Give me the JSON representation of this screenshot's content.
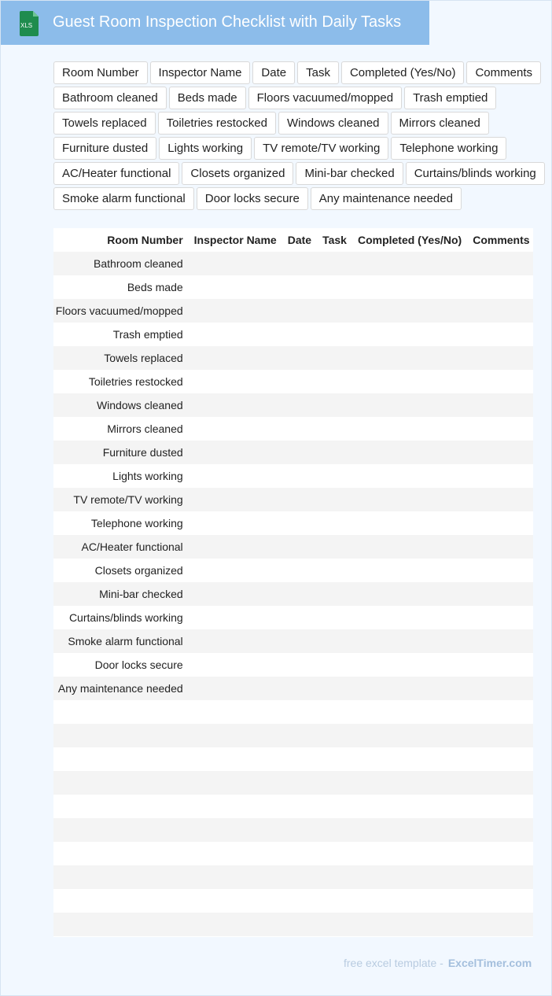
{
  "header": {
    "title": "Guest Room Inspection Checklist with Daily Tasks",
    "icon_label": "XLS"
  },
  "chips": [
    "Room Number",
    "Inspector Name",
    "Date",
    "Task",
    "Completed (Yes/No)",
    "Comments",
    "Bathroom cleaned",
    "Beds made",
    "Floors vacuumed/mopped",
    "Trash emptied",
    "Towels replaced",
    "Toiletries restocked",
    "Windows cleaned",
    "Mirrors cleaned",
    "Furniture dusted",
    "Lights working",
    "TV remote/TV working",
    "Telephone working",
    "AC/Heater functional",
    "Closets organized",
    "Mini-bar checked",
    "Curtains/blinds working",
    "Smoke alarm functional",
    "Door locks secure",
    "Any maintenance needed"
  ],
  "table": {
    "columns": [
      "Room Number",
      "Inspector Name",
      "Date",
      "Task",
      "Completed (Yes/No)",
      "Comments"
    ],
    "rows": [
      {
        "idx": "0",
        "room": "Bathroom cleaned"
      },
      {
        "idx": "1",
        "room": "Beds made"
      },
      {
        "idx": "2",
        "room": "Floors vacuumed/mopped"
      },
      {
        "idx": "3",
        "room": "Trash emptied"
      },
      {
        "idx": "4",
        "room": "Towels replaced"
      },
      {
        "idx": "5",
        "room": "Toiletries restocked"
      },
      {
        "idx": "6",
        "room": "Windows cleaned"
      },
      {
        "idx": "7",
        "room": "Mirrors cleaned"
      },
      {
        "idx": "8",
        "room": "Furniture dusted"
      },
      {
        "idx": "9",
        "room": "Lights working"
      },
      {
        "idx": "0",
        "room": "TV remote/TV working"
      },
      {
        "idx": "1",
        "room": "Telephone working"
      },
      {
        "idx": "2",
        "room": "AC/Heater functional"
      },
      {
        "idx": "3",
        "room": "Closets organized"
      },
      {
        "idx": "4",
        "room": "Mini-bar checked"
      },
      {
        "idx": "5",
        "room": "Curtains/blinds working"
      },
      {
        "idx": "6",
        "room": "Smoke alarm functional"
      },
      {
        "idx": "7",
        "room": "Door locks secure"
      },
      {
        "idx": "8",
        "room": "Any maintenance needed"
      },
      {
        "idx": "9",
        "room": ""
      },
      {
        "idx": "0",
        "room": ""
      },
      {
        "idx": "1",
        "room": ""
      },
      {
        "idx": "2",
        "room": ""
      },
      {
        "idx": "3",
        "room": ""
      },
      {
        "idx": "4",
        "room": ""
      },
      {
        "idx": "5",
        "room": ""
      },
      {
        "idx": "6",
        "room": ""
      },
      {
        "idx": "7",
        "room": ""
      },
      {
        "idx": "8",
        "room": ""
      }
    ]
  },
  "footer": {
    "text": "free excel template -",
    "brand": "ExcelTimer.com"
  },
  "colors": {
    "header_bg": "#8cbcea",
    "icon_green": "#1f8c4e",
    "stripe": "#f4f4f4"
  }
}
